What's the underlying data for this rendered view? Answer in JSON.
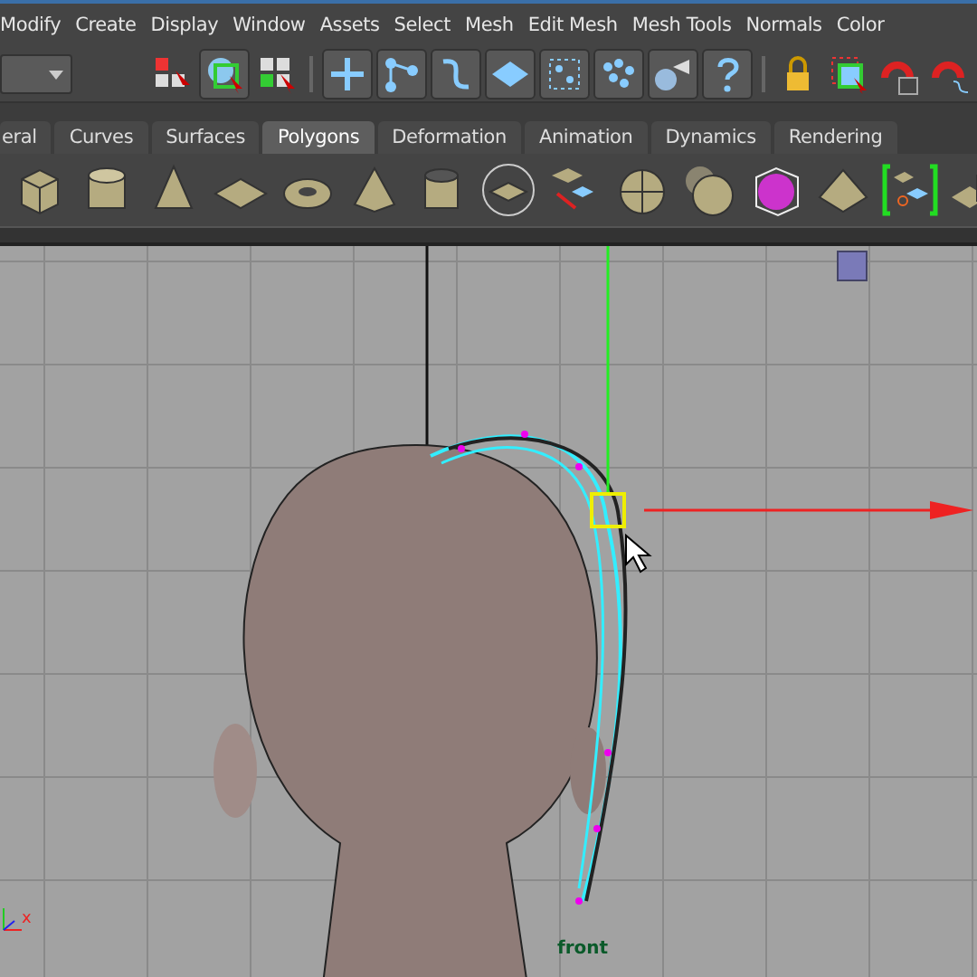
{
  "menu_bar": {
    "items": [
      "Modify",
      "Create",
      "Display",
      "Window",
      "Assets",
      "Select",
      "Mesh",
      "Edit Mesh",
      "Mesh Tools",
      "Normals",
      "Color"
    ]
  },
  "shelf_tabs": [
    {
      "label": "eral",
      "selected": false
    },
    {
      "label": "Curves",
      "selected": false
    },
    {
      "label": "Surfaces",
      "selected": false
    },
    {
      "label": "Polygons",
      "selected": true
    },
    {
      "label": "Deformation",
      "selected": false
    },
    {
      "label": "Animation",
      "selected": false
    },
    {
      "label": "Dynamics",
      "selected": false
    },
    {
      "label": "Rendering",
      "selected": false
    }
  ],
  "viewport": {
    "camera_label": "front",
    "axis_label": "x"
  }
}
